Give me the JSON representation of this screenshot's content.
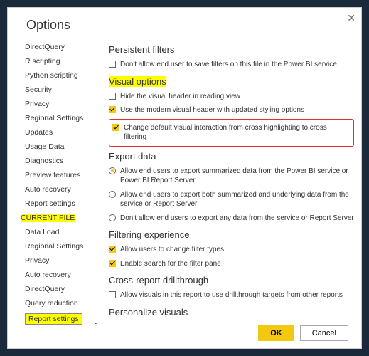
{
  "dialog": {
    "title": "Options"
  },
  "sidebar": {
    "global_items": [
      "DirectQuery",
      "R scripting",
      "Python scripting",
      "Security",
      "Privacy",
      "Regional Settings",
      "Updates",
      "Usage Data",
      "Diagnostics",
      "Preview features",
      "Auto recovery",
      "Report settings"
    ],
    "current_file_header": "CURRENT FILE",
    "current_file_items": [
      "Data Load",
      "Regional Settings",
      "Privacy",
      "Auto recovery",
      "DirectQuery",
      "Query reduction",
      "Report settings"
    ]
  },
  "sections": {
    "persistent": {
      "title": "Persistent filters",
      "opts": [
        "Don't allow end user to save filters on this file in the Power BI service"
      ]
    },
    "visual": {
      "title": "Visual options",
      "opts": [
        "Hide the visual header in reading view",
        "Use the modern visual header with updated styling options",
        "Change default visual interaction from cross highlighting to cross filtering"
      ]
    },
    "export": {
      "title": "Export data",
      "opts": [
        "Allow end users to export summarized data from the Power BI service or Power BI Report Server",
        "Allow end users to export both summarized and underlying data from the service or Report Server",
        "Don't allow end users to export any data from the service or Report Server"
      ]
    },
    "filtering": {
      "title": "Filtering experience",
      "opts": [
        "Allow users to change filter types",
        "Enable search for the filter pane"
      ]
    },
    "cross": {
      "title": "Cross-report drillthrough",
      "opts": [
        "Allow visuals in this report to use drillthrough targets from other reports"
      ]
    },
    "personalize": {
      "title": "Personalize visuals"
    }
  },
  "buttons": {
    "ok": "OK",
    "cancel": "Cancel"
  }
}
